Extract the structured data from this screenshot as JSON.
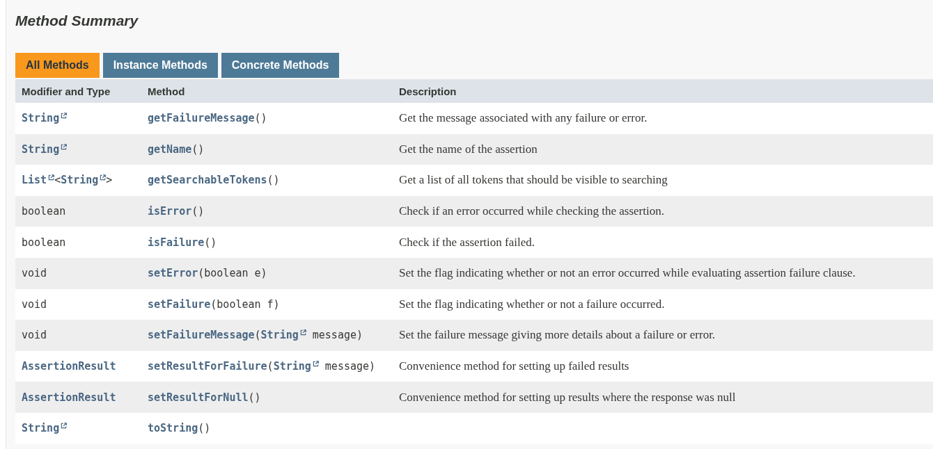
{
  "section_title": "Method Summary",
  "tabs": [
    {
      "label": "All Methods",
      "selected": true
    },
    {
      "label": "Instance Methods",
      "selected": false
    },
    {
      "label": "Concrete Methods",
      "selected": false
    }
  ],
  "table": {
    "columns": [
      "Modifier and Type",
      "Method",
      "Description"
    ],
    "rows": [
      {
        "type": [
          {
            "kind": "link",
            "text": "String",
            "external": true
          }
        ],
        "method": [
          {
            "kind": "name",
            "text": "getFailureMessage"
          },
          {
            "kind": "plain",
            "text": "()"
          }
        ],
        "description": "Get the message associated with any failure or error."
      },
      {
        "type": [
          {
            "kind": "link",
            "text": "String",
            "external": true
          }
        ],
        "method": [
          {
            "kind": "name",
            "text": "getName"
          },
          {
            "kind": "plain",
            "text": "()"
          }
        ],
        "description": "Get the name of the assertion"
      },
      {
        "type": [
          {
            "kind": "link",
            "text": "List",
            "external": true
          },
          {
            "kind": "plain",
            "text": "<"
          },
          {
            "kind": "link",
            "text": "String",
            "external": true
          },
          {
            "kind": "plain",
            "text": ">"
          }
        ],
        "method": [
          {
            "kind": "name",
            "text": "getSearchableTokens"
          },
          {
            "kind": "plain",
            "text": "()"
          }
        ],
        "description": "Get a list of all tokens that should be visible to searching"
      },
      {
        "type": [
          {
            "kind": "plain",
            "text": "boolean"
          }
        ],
        "method": [
          {
            "kind": "name",
            "text": "isError"
          },
          {
            "kind": "plain",
            "text": "()"
          }
        ],
        "description": "Check if an error occurred while checking the assertion."
      },
      {
        "type": [
          {
            "kind": "plain",
            "text": "boolean"
          }
        ],
        "method": [
          {
            "kind": "name",
            "text": "isFailure"
          },
          {
            "kind": "plain",
            "text": "()"
          }
        ],
        "description": "Check if the assertion failed."
      },
      {
        "type": [
          {
            "kind": "plain",
            "text": "void"
          }
        ],
        "method": [
          {
            "kind": "name",
            "text": "setError"
          },
          {
            "kind": "plain",
            "text": "(boolean e)"
          }
        ],
        "description": "Set the flag indicating whether or not an error occurred while evaluating assertion failure clause."
      },
      {
        "type": [
          {
            "kind": "plain",
            "text": "void"
          }
        ],
        "method": [
          {
            "kind": "name",
            "text": "setFailure"
          },
          {
            "kind": "plain",
            "text": "(boolean f)"
          }
        ],
        "description": "Set the flag indicating whether or not a failure occurred."
      },
      {
        "type": [
          {
            "kind": "plain",
            "text": "void"
          }
        ],
        "method": [
          {
            "kind": "name",
            "text": "setFailureMessage"
          },
          {
            "kind": "plain",
            "text": "("
          },
          {
            "kind": "link",
            "text": "String",
            "external": true
          },
          {
            "kind": "plain",
            "text": " message)"
          }
        ],
        "description": "Set the failure message giving more details about a failure or error."
      },
      {
        "type": [
          {
            "kind": "link",
            "text": "AssertionResult",
            "external": false
          }
        ],
        "method": [
          {
            "kind": "name",
            "text": "setResultForFailure"
          },
          {
            "kind": "plain",
            "text": "("
          },
          {
            "kind": "link",
            "text": "String",
            "external": true
          },
          {
            "kind": "plain",
            "text": " message)"
          }
        ],
        "description": "Convenience method for setting up failed results"
      },
      {
        "type": [
          {
            "kind": "link",
            "text": "AssertionResult",
            "external": false
          }
        ],
        "method": [
          {
            "kind": "name",
            "text": "setResultForNull"
          },
          {
            "kind": "plain",
            "text": "()"
          }
        ],
        "description": "Convenience method for setting up results where the response was null"
      },
      {
        "type": [
          {
            "kind": "link",
            "text": "String",
            "external": true
          }
        ],
        "method": [
          {
            "kind": "name",
            "text": "toString"
          },
          {
            "kind": "plain",
            "text": "()"
          }
        ]
      }
    ]
  }
}
